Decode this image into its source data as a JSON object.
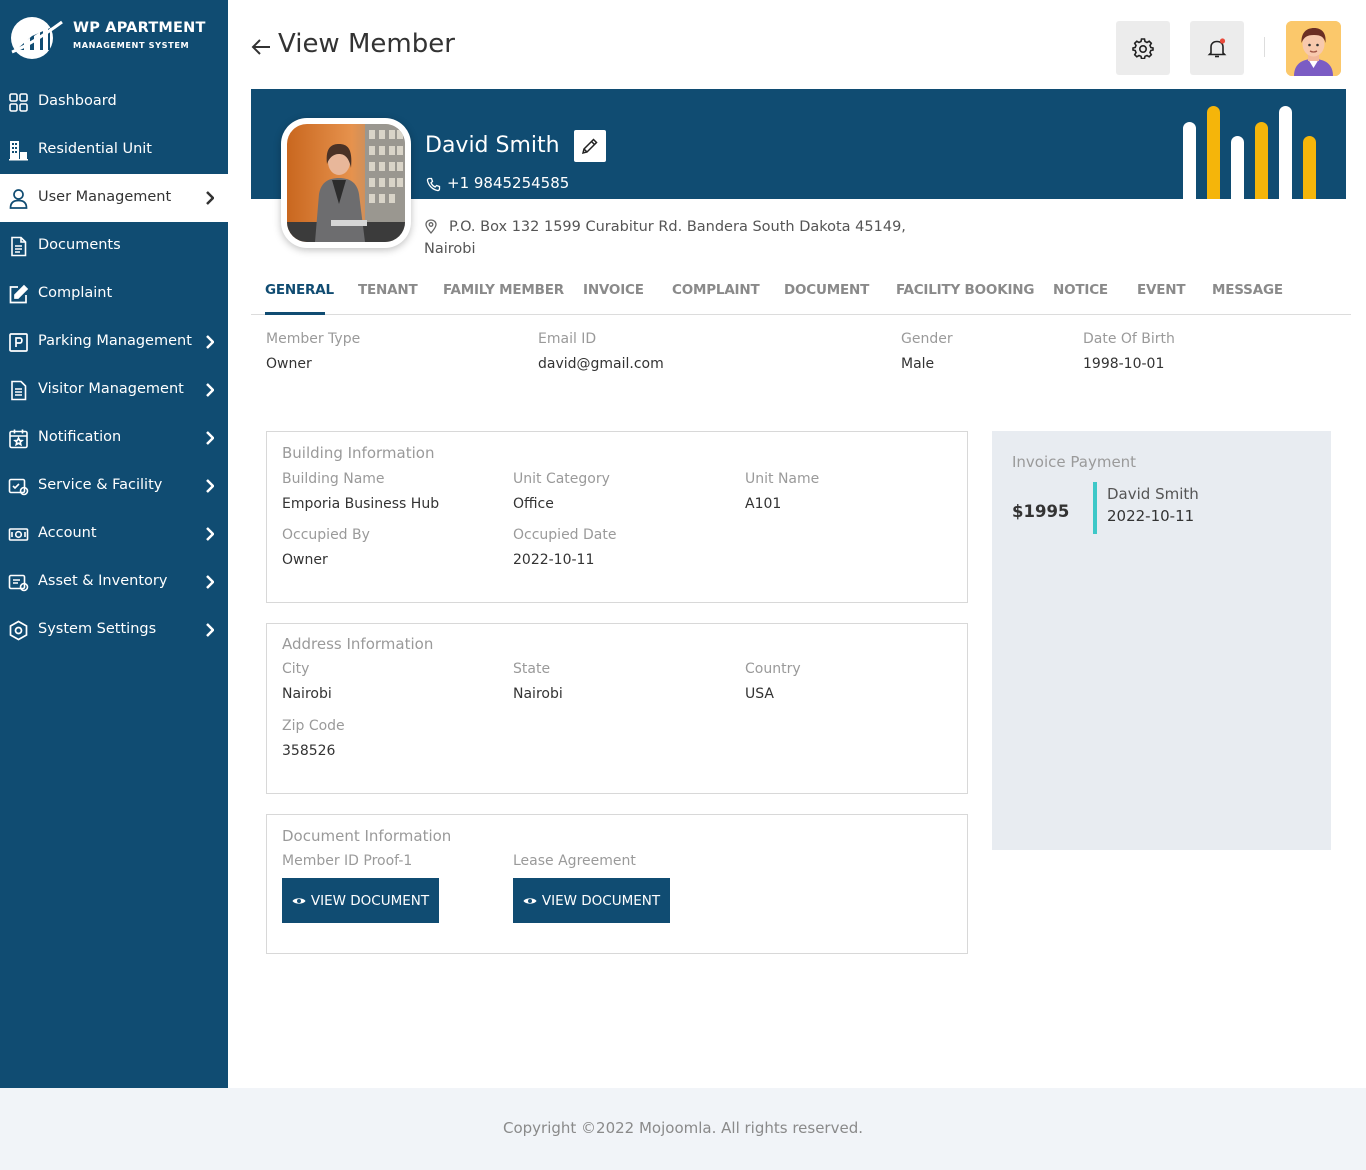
{
  "brand": {
    "title": "WP APARTMENT",
    "subtitle": "MANAGEMENT SYSTEM"
  },
  "sidebar": {
    "items": [
      {
        "label": "Dashboard",
        "icon": "dashboard-grid-icon",
        "has_chevron": false
      },
      {
        "label": "Residential Unit",
        "icon": "building-icon",
        "has_chevron": false
      },
      {
        "label": "User Management",
        "icon": "user-icon",
        "has_chevron": true,
        "active": true
      },
      {
        "label": "Documents",
        "icon": "document-icon",
        "has_chevron": false
      },
      {
        "label": "Complaint",
        "icon": "edit-square-icon",
        "has_chevron": false
      },
      {
        "label": "Parking Management",
        "icon": "parking-icon",
        "has_chevron": true
      },
      {
        "label": "Visitor Management",
        "icon": "clipboard-icon",
        "has_chevron": true
      },
      {
        "label": "Notification",
        "icon": "calendar-star-icon",
        "has_chevron": true
      },
      {
        "label": "Service & Facility",
        "icon": "service-icon",
        "has_chevron": true
      },
      {
        "label": "Account",
        "icon": "money-icon",
        "has_chevron": true
      },
      {
        "label": "Asset & Inventory",
        "icon": "asset-icon",
        "has_chevron": true
      },
      {
        "label": "System Settings",
        "icon": "settings-icon",
        "has_chevron": true
      }
    ]
  },
  "header": {
    "title": "View Member"
  },
  "profile": {
    "name": "David Smith",
    "phone": "+1  9845254585",
    "address": "P.O. Box 132 1599 Curabitur Rd. Bandera South Dakota 45149, Nairobi"
  },
  "tabs": [
    {
      "label": "GENERAL",
      "active": true
    },
    {
      "label": "TENANT"
    },
    {
      "label": "FAMILY MEMBER"
    },
    {
      "label": "INVOICE"
    },
    {
      "label": "COMPLAINT"
    },
    {
      "label": "DOCUMENT"
    },
    {
      "label": "FACILITY BOOKING"
    },
    {
      "label": "NOTICE"
    },
    {
      "label": "EVENT"
    },
    {
      "label": "MESSAGE"
    }
  ],
  "general": {
    "member_type_label": "Member Type",
    "member_type": "Owner",
    "email_label": "Email ID",
    "email": "david@gmail.com",
    "gender_label": "Gender",
    "gender": "Male",
    "dob_label": "Date Of Birth",
    "dob": "1998-10-01"
  },
  "building": {
    "title": "Building Information",
    "building_name_label": "Building Name",
    "building_name": "Emporia Business Hub",
    "unit_category_label": "Unit Category",
    "unit_category": "Office",
    "unit_name_label": "Unit Name",
    "unit_name": "A101",
    "occupied_by_label": "Occupied By",
    "occupied_by": "Owner",
    "occupied_date_label": "Occupied Date",
    "occupied_date": "2022-10-11"
  },
  "address_info": {
    "title": "Address Information",
    "city_label": "City",
    "city": "Nairobi",
    "state_label": "State",
    "state": "Nairobi",
    "country_label": "Country",
    "country": "USA",
    "zip_label": "Zip Code",
    "zip": "358526"
  },
  "documents": {
    "title": "Document Information",
    "doc1_label": "Member ID Proof-1",
    "doc2_label": "Lease Agreement",
    "button_label": "VIEW DOCUMENT"
  },
  "invoice": {
    "title": "Invoice Payment",
    "amount": "$1995",
    "name": "David Smith",
    "date": "2022-10-11"
  },
  "footer": {
    "text": "Copyright ©2022 Mojoomla. All rights reserved."
  },
  "colors": {
    "primary": "#104c72",
    "accent": "#f5b50a",
    "teal": "#3ec8c8",
    "notification_dot": "#e94b3c"
  }
}
